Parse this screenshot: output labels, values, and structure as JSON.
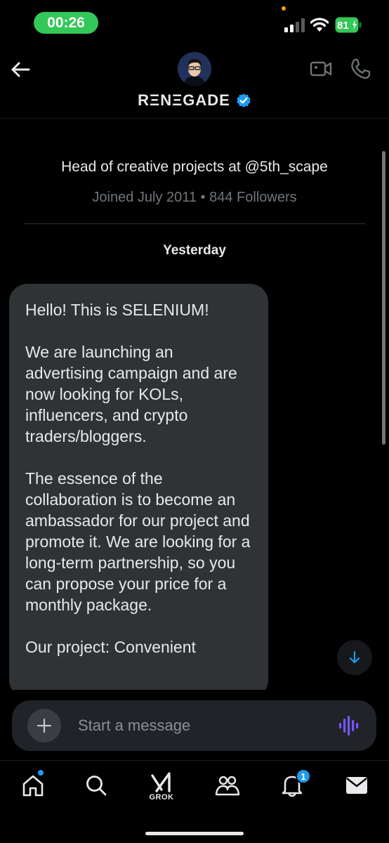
{
  "status_bar": {
    "time": "00:26",
    "battery": "81",
    "accent_green": "#34c759"
  },
  "header": {
    "name": "RΞNΞGADE",
    "verified": true,
    "icons": [
      "back-arrow-icon",
      "video-call-icon",
      "phone-icon"
    ]
  },
  "profile": {
    "bio": "Head of creative projects at @5th_scape",
    "meta": "Joined July 2011 • 844 Followers"
  },
  "conversation": {
    "day_label": "Yesterday",
    "messages": [
      {
        "paragraphs": [
          "Hello! This is SELENIUM!",
          "We are launching an advertising campaign and are now looking for KOLs, influencers, and crypto traders/bloggers.",
          "The essence of the collaboration is to become an ambassador for our project and promote it. We are looking for a long-term partnership, so you can propose your price for a monthly package.",
          "Our project: Convenient"
        ]
      }
    ]
  },
  "composer": {
    "placeholder": "Start a message"
  },
  "tabbar": {
    "grok_label": "GROK",
    "notification_count": "1",
    "accent_blue": "#1d9bf0",
    "icons": [
      "home-icon",
      "search-icon",
      "grok-icon",
      "communities-icon",
      "notifications-icon",
      "messages-icon"
    ]
  }
}
